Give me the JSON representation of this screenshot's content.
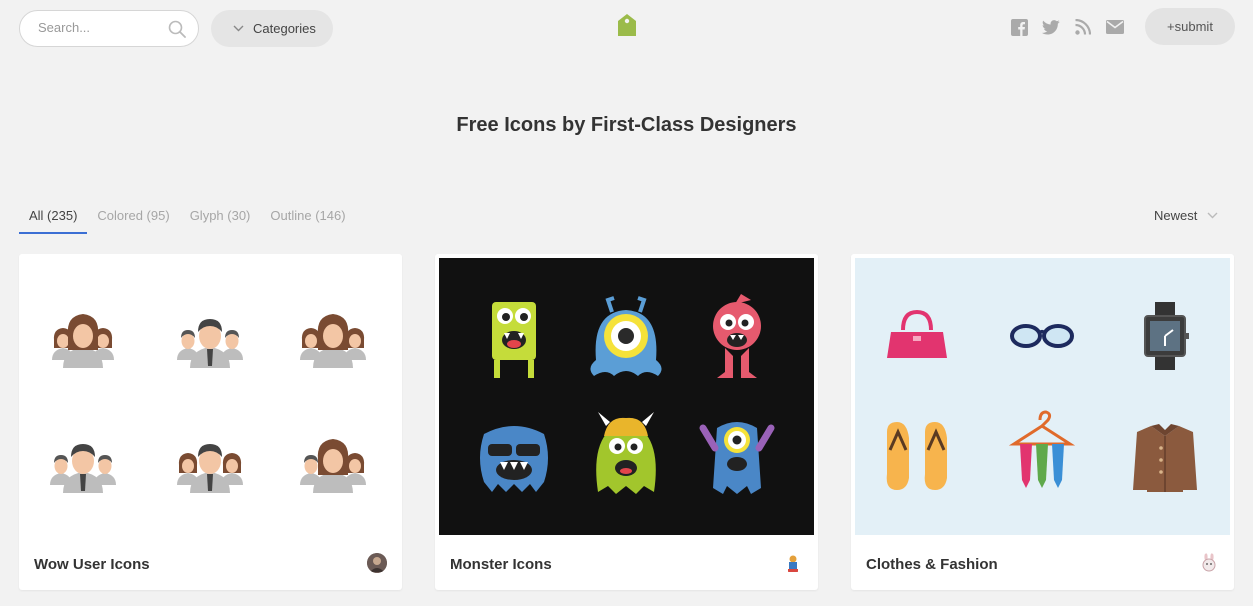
{
  "header": {
    "search_placeholder": "Search...",
    "categories_label": "Categories",
    "submit_label": "+submit",
    "social_icons": [
      "facebook-icon",
      "twitter-icon",
      "rss-icon",
      "mail-icon"
    ],
    "logo_icon": "tag-icon",
    "logo_color": "#9bbb4a"
  },
  "page": {
    "title": "Free Icons by First-Class Designers"
  },
  "filters": {
    "tabs": [
      {
        "label": "All (235)",
        "active": true
      },
      {
        "label": "Colored (95)",
        "active": false
      },
      {
        "label": "Glyph (30)",
        "active": false
      },
      {
        "label": "Outline (146)",
        "active": false
      }
    ],
    "sort_label": "Newest",
    "active_tab_color": "#3b6fd4"
  },
  "cards": [
    {
      "title": "Wow User Icons",
      "background": "#ffffff",
      "avatar_icon": "designer-avatar-icon"
    },
    {
      "title": "Monster Icons",
      "background": "#111111",
      "avatar_icon": "designer-avatar-icon"
    },
    {
      "title": "Clothes & Fashion",
      "background": "#e3f0f7",
      "avatar_icon": "designer-avatar-icon"
    }
  ]
}
